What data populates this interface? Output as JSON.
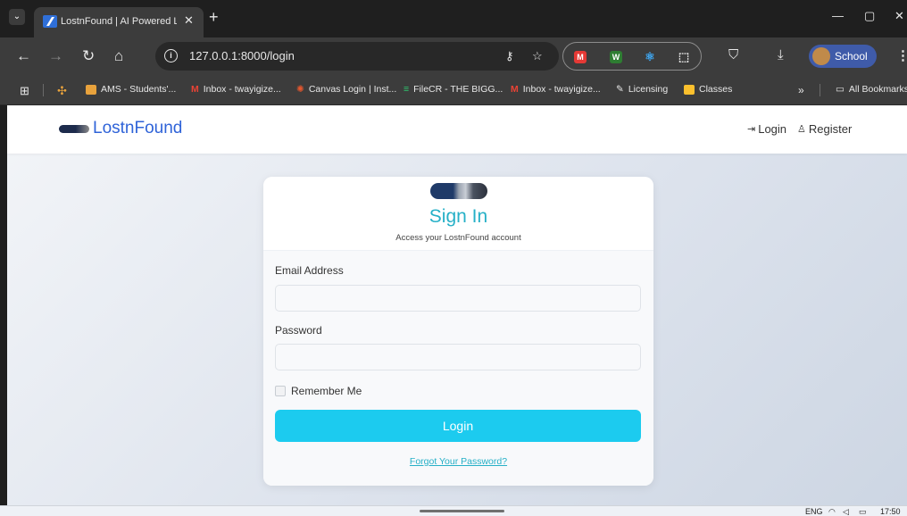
{
  "browser": {
    "tab": {
      "title": "LostnFound | AI Powered Lo"
    },
    "address": {
      "url": "127.0.0.1:8000/login"
    },
    "profile": {
      "label": "School"
    },
    "bookmarks": [
      {
        "label": "AMS - Students'...",
        "color": "#e8a23c"
      },
      {
        "label": "Inbox - twayigize...",
        "color": "#ea4335"
      },
      {
        "label": "Canvas Login | Inst...",
        "color": "#e4572e"
      },
      {
        "label": "FileCR - THE BIGG...",
        "color": "#2ecc71"
      },
      {
        "label": "Inbox - twayigize...",
        "color": "#ea4335"
      },
      {
        "label": "Licensing",
        "color": "#e8e8e8"
      },
      {
        "label": "Classes",
        "color": "#fbc02d"
      }
    ],
    "all_bookmarks": "All Bookmarks",
    "more_bookmarks": "»"
  },
  "page": {
    "brand": {
      "name": "LostnFound"
    },
    "nav": {
      "login": "Login",
      "register": "Register"
    },
    "card": {
      "title": "Sign In",
      "subtitle": "Access your LostnFound account",
      "email_label": "Email Address",
      "email_value": "",
      "password_label": "Password",
      "password_value": "",
      "remember_label": "Remember Me",
      "remember_checked": false,
      "submit_label": "Login",
      "forgot_link": "Forgot Your Password?"
    },
    "colors": {
      "accent": "#26b0c7",
      "button": "#1ccbef",
      "brand": "#2f63d8"
    }
  },
  "taskbar": {
    "language": "ENG",
    "time": "17:50"
  }
}
